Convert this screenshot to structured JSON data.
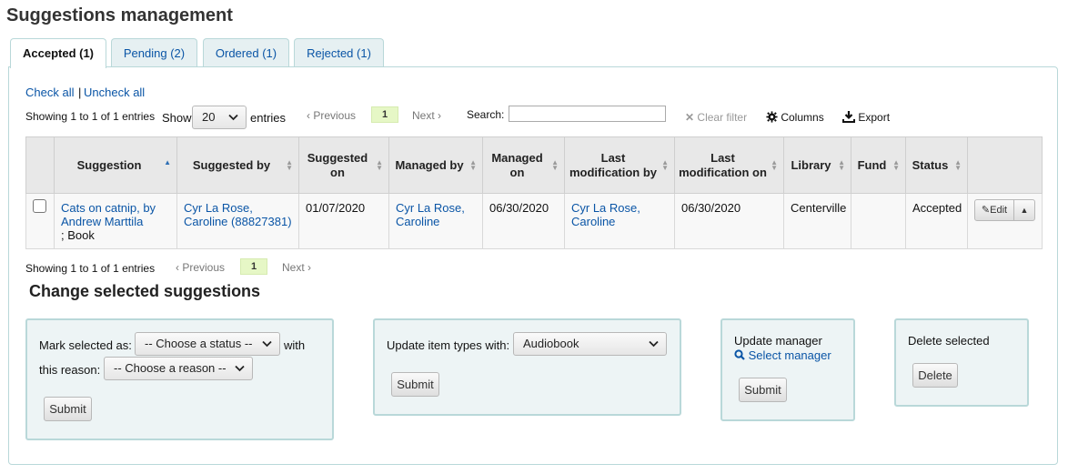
{
  "page": {
    "title": "Suggestions management"
  },
  "tabs": [
    {
      "label": "Accepted (1)"
    },
    {
      "label": "Pending (2)"
    },
    {
      "label": "Ordered (1)"
    },
    {
      "label": "Rejected (1)"
    }
  ],
  "toolbar": {
    "check_all": "Check all",
    "separator": "|",
    "uncheck_all": "Uncheck all",
    "showing_top": "Showing 1 to 1 of 1 entries",
    "show_label": "Show",
    "show_value": "20",
    "entries_label": "entries",
    "previous": "Previous",
    "current_page": "1",
    "next": "Next",
    "search_label": "Search:",
    "search_value": "",
    "clear_filter": "Clear filter",
    "columns": "Columns",
    "export": "Export"
  },
  "table": {
    "headers": [
      "Suggestion",
      "Suggested by",
      "Suggested on",
      "Managed by",
      "Managed on",
      "Last modification by",
      "Last modification on",
      "Library",
      "Fund",
      "Status"
    ],
    "rows": [
      {
        "suggestion_link": "Cats on catnip, by Andrew Marttila",
        "suggestion_type": "; Book",
        "suggested_by": "Cyr La Rose, Caroline (88827381)",
        "suggested_on": "01/07/2020",
        "managed_by": "Cyr La Rose, Caroline",
        "managed_on": "06/30/2020",
        "last_mod_by": "Cyr La Rose, Caroline",
        "last_mod_on": "06/30/2020",
        "library": "Centerville",
        "fund": "",
        "status": "Accepted",
        "edit": "Edit"
      }
    ]
  },
  "bottom_pager": {
    "showing": "Showing 1 to 1 of 1 entries",
    "previous": "Previous",
    "current_page": "1",
    "next": "Next"
  },
  "change": {
    "title": "Change selected suggestions",
    "mark_label": "Mark selected as:",
    "status_select": "-- Choose a status --",
    "with_label": "with",
    "reason_label": "this reason:",
    "reason_select": "-- Choose a reason --",
    "submit": "Submit",
    "item_types_label": "Update item types with:",
    "item_type_select": "Audiobook",
    "update_manager_label": "Update manager",
    "select_manager": "Select manager",
    "delete_label": "Delete selected",
    "delete_button": "Delete"
  },
  "colors": {
    "link": "#0a55a6",
    "tab_bg": "#e6f0f2",
    "border": "#b9d8d9",
    "current_page_bg": "#e6f7c6",
    "table_header_bg": "#e8e8e8"
  }
}
